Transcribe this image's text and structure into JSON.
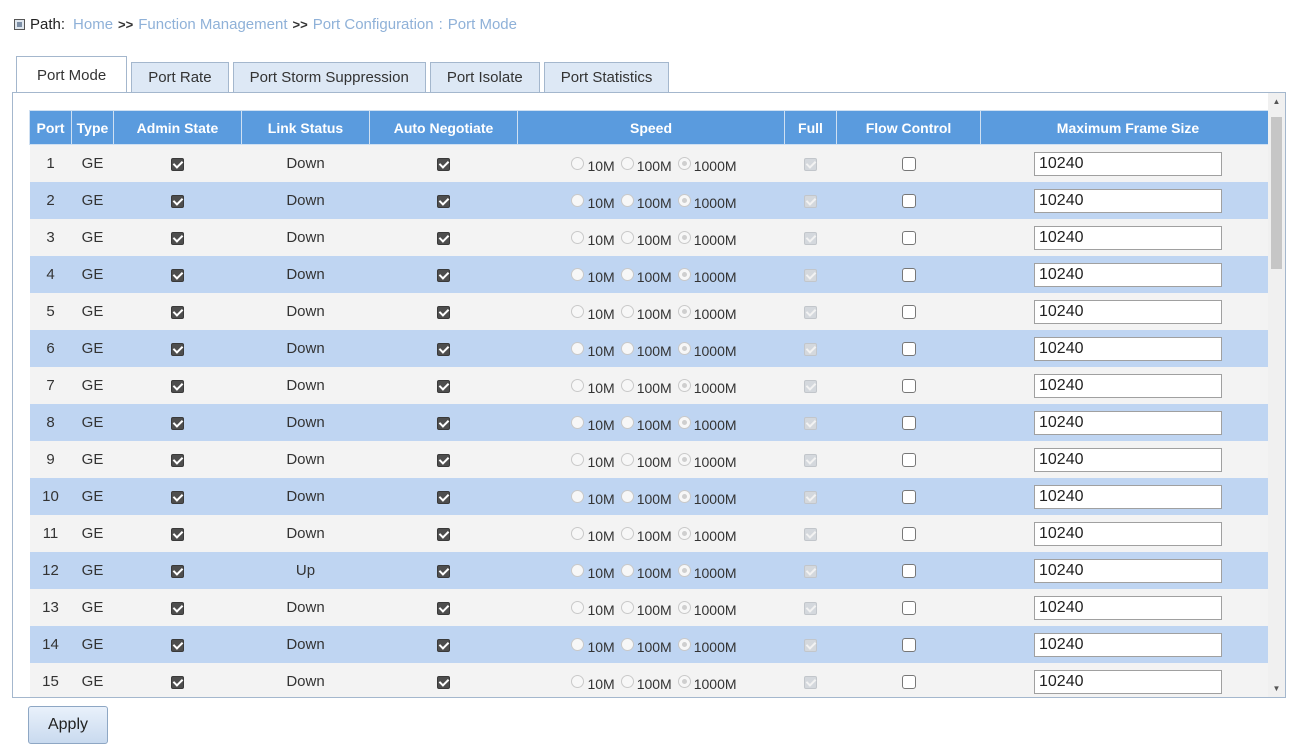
{
  "breadcrumb": {
    "label": "Path:",
    "home": "Home",
    "sep": ">>",
    "function_management": "Function Management",
    "port_configuration": "Port Configuration",
    "colon": ":",
    "port_mode": "Port Mode"
  },
  "tabs": [
    {
      "label": "Port Mode",
      "active": true
    },
    {
      "label": "Port Rate",
      "active": false
    },
    {
      "label": "Port Storm Suppression",
      "active": false
    },
    {
      "label": "Port Isolate",
      "active": false
    },
    {
      "label": "Port Statistics",
      "active": false
    }
  ],
  "columns": [
    "Port",
    "Type",
    "Admin State",
    "Link Status",
    "Auto Negotiate",
    "Speed",
    "Full",
    "Flow Control",
    "Maximum Frame Size"
  ],
  "speed_options": [
    "10M",
    "100M",
    "1000M"
  ],
  "rows": [
    {
      "port": "1",
      "type": "GE",
      "admin": true,
      "link": "Down",
      "auto": true,
      "speed": "1000M",
      "full": true,
      "flow": false,
      "frame": "10240"
    },
    {
      "port": "2",
      "type": "GE",
      "admin": true,
      "link": "Down",
      "auto": true,
      "speed": "1000M",
      "full": true,
      "flow": false,
      "frame": "10240"
    },
    {
      "port": "3",
      "type": "GE",
      "admin": true,
      "link": "Down",
      "auto": true,
      "speed": "1000M",
      "full": true,
      "flow": false,
      "frame": "10240"
    },
    {
      "port": "4",
      "type": "GE",
      "admin": true,
      "link": "Down",
      "auto": true,
      "speed": "1000M",
      "full": true,
      "flow": false,
      "frame": "10240"
    },
    {
      "port": "5",
      "type": "GE",
      "admin": true,
      "link": "Down",
      "auto": true,
      "speed": "1000M",
      "full": true,
      "flow": false,
      "frame": "10240"
    },
    {
      "port": "6",
      "type": "GE",
      "admin": true,
      "link": "Down",
      "auto": true,
      "speed": "1000M",
      "full": true,
      "flow": false,
      "frame": "10240"
    },
    {
      "port": "7",
      "type": "GE",
      "admin": true,
      "link": "Down",
      "auto": true,
      "speed": "1000M",
      "full": true,
      "flow": false,
      "frame": "10240"
    },
    {
      "port": "8",
      "type": "GE",
      "admin": true,
      "link": "Down",
      "auto": true,
      "speed": "1000M",
      "full": true,
      "flow": false,
      "frame": "10240"
    },
    {
      "port": "9",
      "type": "GE",
      "admin": true,
      "link": "Down",
      "auto": true,
      "speed": "1000M",
      "full": true,
      "flow": false,
      "frame": "10240"
    },
    {
      "port": "10",
      "type": "GE",
      "admin": true,
      "link": "Down",
      "auto": true,
      "speed": "1000M",
      "full": true,
      "flow": false,
      "frame": "10240"
    },
    {
      "port": "11",
      "type": "GE",
      "admin": true,
      "link": "Down",
      "auto": true,
      "speed": "1000M",
      "full": true,
      "flow": false,
      "frame": "10240"
    },
    {
      "port": "12",
      "type": "GE",
      "admin": true,
      "link": "Up",
      "auto": true,
      "speed": "1000M",
      "full": true,
      "flow": false,
      "frame": "10240"
    },
    {
      "port": "13",
      "type": "GE",
      "admin": true,
      "link": "Down",
      "auto": true,
      "speed": "1000M",
      "full": true,
      "flow": false,
      "frame": "10240"
    },
    {
      "port": "14",
      "type": "GE",
      "admin": true,
      "link": "Down",
      "auto": true,
      "speed": "1000M",
      "full": true,
      "flow": false,
      "frame": "10240"
    },
    {
      "port": "15",
      "type": "GE",
      "admin": true,
      "link": "Down",
      "auto": true,
      "speed": "1000M",
      "full": true,
      "flow": false,
      "frame": "10240"
    }
  ],
  "apply_label": "Apply",
  "colors": {
    "header_bg": "#5a9bde",
    "row_even": "#bfd5f2",
    "row_odd": "#f3f3f3",
    "link_text": "#8fb1d8"
  }
}
